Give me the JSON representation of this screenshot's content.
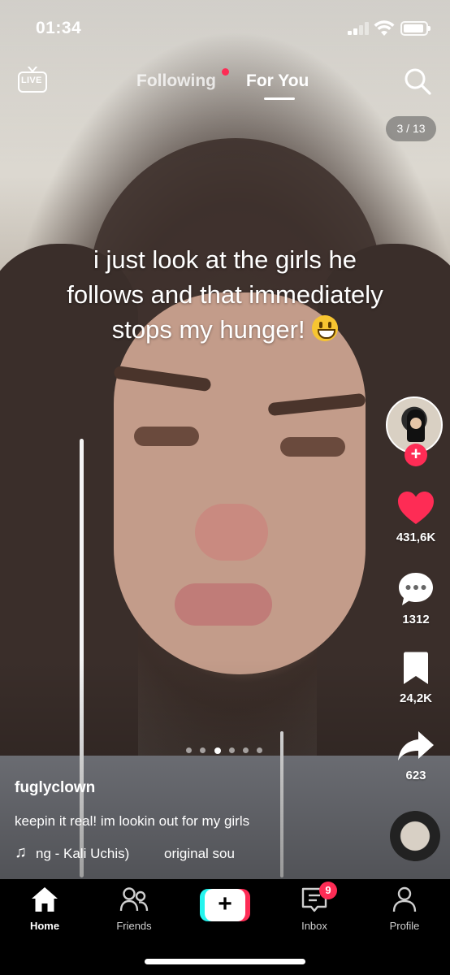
{
  "status_bar": {
    "time": "01:34"
  },
  "top_nav": {
    "live_label": "LIVE",
    "tabs": [
      {
        "label": "Following",
        "active": false,
        "has_dot": true
      },
      {
        "label": "For You",
        "active": true
      }
    ],
    "photo_counter": "3 / 13"
  },
  "caption": {
    "line1": "i just look at the girls he",
    "line2": "follows and that immediately",
    "line3": "stops my hunger!",
    "emoji": "grinning-face-emoji"
  },
  "actions": {
    "likes": "431,6K",
    "comments": "1312",
    "saves": "24,2K",
    "shares": "623"
  },
  "carousel": {
    "count": 6,
    "active_index": 2
  },
  "post": {
    "username": "fuglyclown",
    "description": "keepin it real! im lookin out for my girls",
    "music_a": "ng - Kali Uchis)",
    "music_b": "original sou"
  },
  "tabbar": {
    "home": "Home",
    "friends": "Friends",
    "inbox": "Inbox",
    "inbox_badge": "9",
    "profile": "Profile"
  },
  "colors": {
    "accent_red": "#fe2c55",
    "accent_cyan": "#25f4ee",
    "bar_bg": "#000000"
  }
}
